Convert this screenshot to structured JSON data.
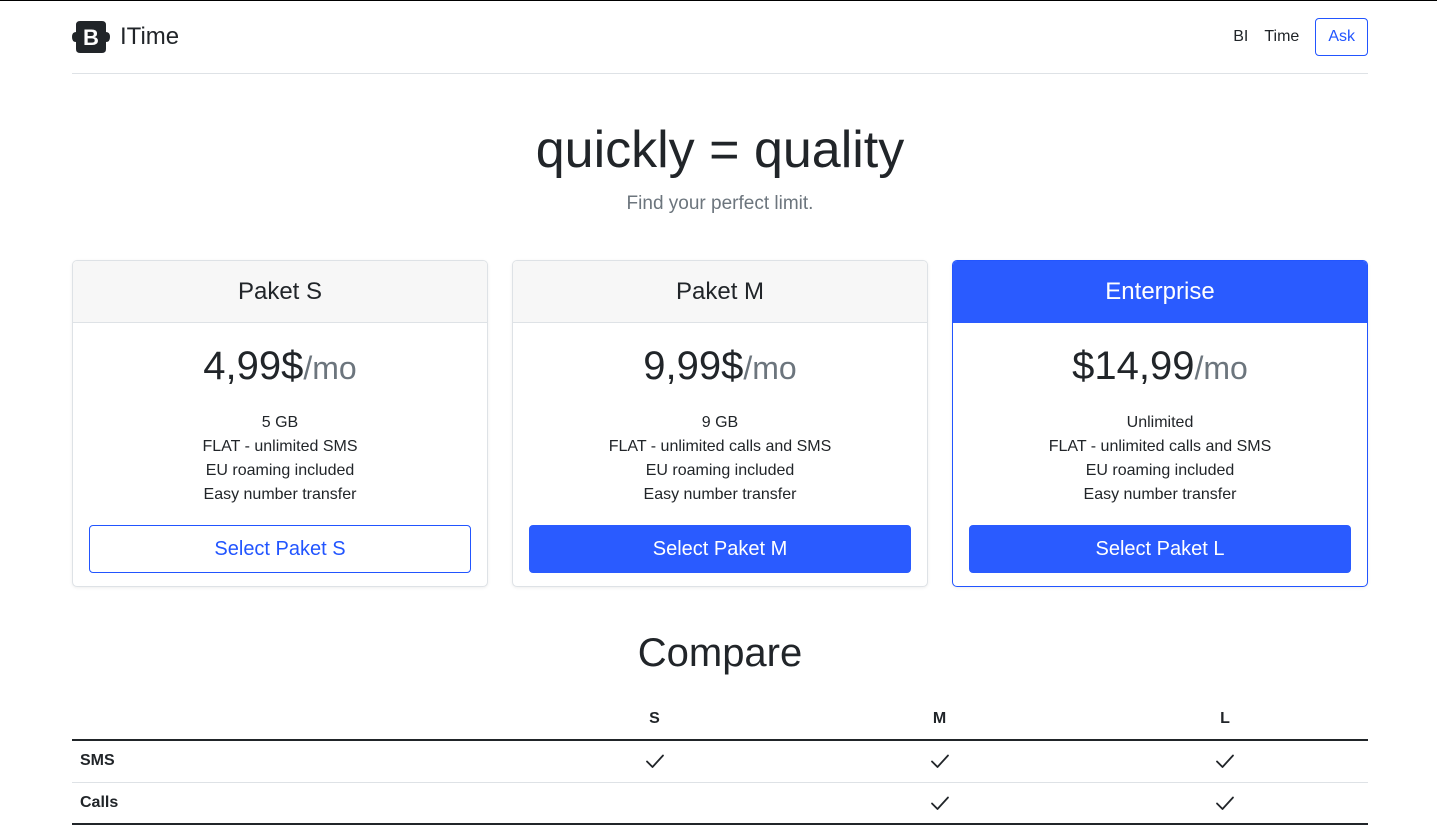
{
  "brand": {
    "name": "ITime",
    "logo_letter": "B"
  },
  "nav": {
    "items": [
      "BI",
      "Time"
    ],
    "ask_label": "Ask"
  },
  "hero": {
    "title": "quickly = quality",
    "subtitle": "Find your perfect limit."
  },
  "plans": [
    {
      "name": "Paket S",
      "price": "4,99$",
      "per": "/mo",
      "features": [
        "5 GB",
        "FLAT - unlimited SMS",
        "EU roaming included",
        "Easy number transfer"
      ],
      "button": "Select Paket S",
      "style": "outline"
    },
    {
      "name": "Paket M",
      "price": "9,99$",
      "per": "/mo",
      "features": [
        "9 GB",
        "FLAT - unlimited calls and SMS",
        "EU roaming included",
        "Easy number transfer"
      ],
      "button": "Select Paket M",
      "style": "solid"
    },
    {
      "name": "Enterprise",
      "price": "$14,99",
      "per": "/mo",
      "features": [
        "Unlimited",
        "FLAT - unlimited calls and SMS",
        "EU roaming included",
        "Easy number transfer"
      ],
      "button": "Select Paket L",
      "style": "solid",
      "highlight": true
    }
  ],
  "compare": {
    "title": "Compare",
    "columns": [
      "",
      "S",
      "M",
      "L"
    ],
    "rows": [
      {
        "feature": "SMS",
        "checks": [
          true,
          true,
          true
        ]
      },
      {
        "feature": "Calls",
        "checks": [
          false,
          true,
          true
        ]
      }
    ]
  },
  "colors": {
    "primary": "#2a5bff",
    "text": "#212529",
    "muted": "#6c757d"
  },
  "icons": {
    "check": "check-icon",
    "logo": "bootstrap-logo-icon"
  }
}
